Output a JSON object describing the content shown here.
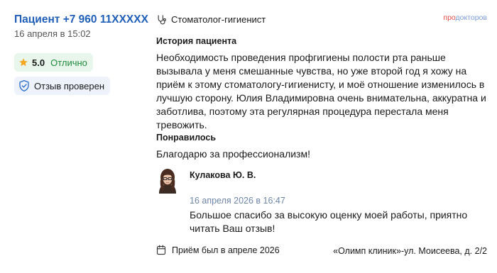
{
  "patient": {
    "name": "Пациент +7 960 11XXXXX",
    "date": "16 апреля в 15:02"
  },
  "rating": {
    "value": "5.0",
    "label": "Отлично",
    "star_color": "#f5a623"
  },
  "verified": {
    "label": "Отзыв проверен"
  },
  "specialty": {
    "label": "Стоматолог-гигиенист"
  },
  "brand": {
    "part1": "про",
    "part2": "докторов"
  },
  "history": {
    "title": "История пациента",
    "text": "Необходимость проведения профгигиены полости рта раньше вызывала у меня смешанные чувства, но уже второй год я хожу на приём к этому стоматологу-гигиенисту, и моё отношение изменилось в лучшую сторону. Юлия Владимировна очень внимательна, аккуратна и заботлива, поэтому эта регулярная процедура перестала меня тревожить."
  },
  "liked": {
    "title": "Понравилось",
    "text": "Благодарю за профессионализм!"
  },
  "reply": {
    "doctor_name": "Кулакова Ю. В.",
    "date": "16 апреля 2026 в 16:47",
    "text": "Большое спасибо за высокую оценку моей работы, приятно читать Ваш отзыв!"
  },
  "footer": {
    "visit": "Приём был в апреле  2026",
    "clinic": "«Олимп клиник»-ул. Моисеева, д. 2/2"
  },
  "colors": {
    "link_blue": "#1f5fb8",
    "rating_green": "#1f8a3c",
    "rating_bg": "#e8f6ec",
    "verified_bg": "#eef3fb"
  },
  "icons": [
    "star-icon",
    "shield-check-icon",
    "stethoscope-icon",
    "calendar-icon"
  ]
}
